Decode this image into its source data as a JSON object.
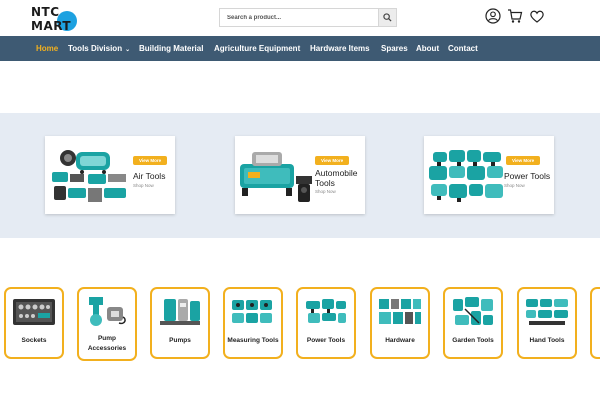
{
  "logo": {
    "line1_a": "NTC",
    "line2": "MART"
  },
  "search": {
    "placeholder": "Search a product..."
  },
  "nav": {
    "items": [
      "Home",
      "Tools Division",
      "Building Material",
      "Agriculture Equipment",
      "Hardware Items",
      "Spares",
      "About",
      "Contact"
    ],
    "dropdown_chevron": "⌄"
  },
  "banners": [
    {
      "title": "Air Tools",
      "button": "View More",
      "link": "Shop Now"
    },
    {
      "title": "Automobile Tools",
      "title_line1": "Automobile",
      "title_line2": "Tools",
      "button": "View More",
      "link": "Shop Now"
    },
    {
      "title": "Power Tools",
      "button": "View More",
      "link": "Shop Now"
    }
  ],
  "categories": [
    {
      "label": "Sockets"
    },
    {
      "label": "Pump Accessories",
      "line1": "Pump",
      "line2": "Accessories"
    },
    {
      "label": "Pumps"
    },
    {
      "label": "Measuring Tools"
    },
    {
      "label": "Power Tools"
    },
    {
      "label": "Hardware"
    },
    {
      "label": "Garden Tools"
    },
    {
      "label": "Hand Tools"
    }
  ],
  "colors": {
    "nav_bg": "#3e5a73",
    "accent": "#f2b01e",
    "band_bg": "#e5ebf3",
    "tool_teal": "#1aa3a3"
  }
}
